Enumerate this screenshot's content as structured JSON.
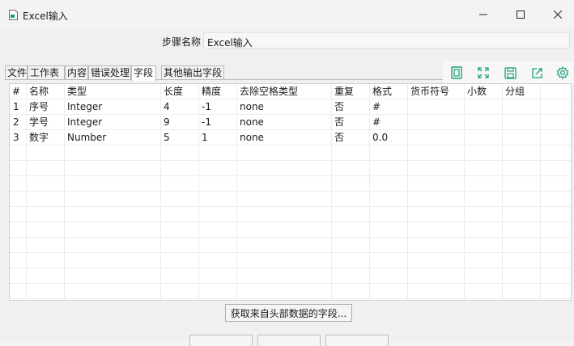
{
  "window": {
    "title": "Excel输入"
  },
  "step": {
    "label": "步骤名称",
    "value": "Excel输入"
  },
  "tabs": [
    {
      "label": "文件"
    },
    {
      "label": "工作表"
    },
    {
      "label": "内容"
    },
    {
      "label": "错误处理"
    },
    {
      "label": "字段"
    },
    {
      "label": "其他输出字段"
    }
  ],
  "toolbar": [
    "copy-icon",
    "expand-icon",
    "save-icon",
    "export-icon",
    "settings-icon"
  ],
  "accent_color": "#1aa179",
  "grid": {
    "columns": [
      "#",
      "名称",
      "类型",
      "长度",
      "精度",
      "去除空格类型",
      "重复",
      "格式",
      "货币符号",
      "小数",
      "分组"
    ],
    "rows": [
      [
        "1",
        "序号",
        "Integer",
        "4",
        "-1",
        "none",
        "否",
        "#",
        "",
        "",
        ""
      ],
      [
        "2",
        "学号",
        "Integer",
        "9",
        "-1",
        "none",
        "否",
        "#",
        "",
        "",
        ""
      ],
      [
        "3",
        "数字",
        "Number",
        "5",
        "1",
        "none",
        "否",
        "0.0",
        "",
        "",
        ""
      ]
    ]
  },
  "fetch_button": {
    "label": "获取来自头部数据的字段..."
  }
}
